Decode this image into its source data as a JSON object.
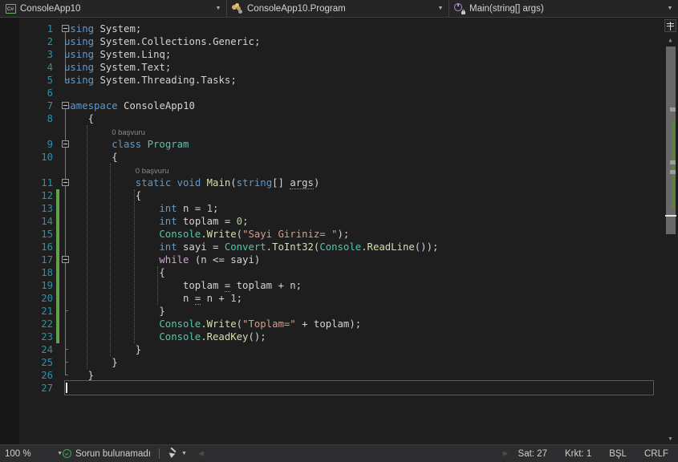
{
  "navbar": {
    "project": {
      "icon": "csharp-file-icon",
      "label": "ConsoleApp10"
    },
    "type": {
      "icon": "class-icon",
      "label": "ConsoleApp10.Program"
    },
    "member": {
      "icon": "method-private-icon",
      "label": "Main(string[] args)"
    }
  },
  "editor": {
    "first_line": 1,
    "codelens": [
      {
        "line": 9,
        "text": "0 başvuru"
      },
      {
        "line": 11,
        "text": "0 başvuru"
      }
    ],
    "lines": [
      {
        "n": 1,
        "tokens": [
          {
            "t": "using",
            "c": "k"
          },
          {
            "t": " ",
            "c": "pn"
          },
          {
            "t": "System",
            "c": "id"
          },
          {
            "t": ";",
            "c": "pn"
          }
        ],
        "indent": 0
      },
      {
        "n": 2,
        "tokens": [
          {
            "t": "using",
            "c": "k"
          },
          {
            "t": " ",
            "c": "pn"
          },
          {
            "t": "System.Collections.Generic",
            "c": "id"
          },
          {
            "t": ";",
            "c": "pn"
          }
        ],
        "indent": 0
      },
      {
        "n": 3,
        "tokens": [
          {
            "t": "using",
            "c": "k"
          },
          {
            "t": " ",
            "c": "pn"
          },
          {
            "t": "System.Linq",
            "c": "id"
          },
          {
            "t": ";",
            "c": "pn"
          }
        ],
        "indent": 0
      },
      {
        "n": 4,
        "tokens": [
          {
            "t": "using",
            "c": "k"
          },
          {
            "t": " ",
            "c": "pn"
          },
          {
            "t": "System.Text",
            "c": "id"
          },
          {
            "t": ";",
            "c": "pn"
          }
        ],
        "indent": 0
      },
      {
        "n": 5,
        "tokens": [
          {
            "t": "using",
            "c": "k"
          },
          {
            "t": " ",
            "c": "pn"
          },
          {
            "t": "System.Threading.Tasks",
            "c": "id"
          },
          {
            "t": ";",
            "c": "pn"
          }
        ],
        "indent": 0
      },
      {
        "n": 6,
        "tokens": [],
        "indent": 0
      },
      {
        "n": 7,
        "tokens": [
          {
            "t": "namespace",
            "c": "k"
          },
          {
            "t": " ",
            "c": "pn"
          },
          {
            "t": "ConsoleApp10",
            "c": "id"
          }
        ],
        "indent": 0
      },
      {
        "n": 8,
        "tokens": [
          {
            "t": "{",
            "c": "pn"
          }
        ],
        "indent": 1
      },
      {
        "n": 9,
        "tokens": [
          {
            "t": "class",
            "c": "k"
          },
          {
            "t": " ",
            "c": "pn"
          },
          {
            "t": "Program",
            "c": "ty"
          }
        ],
        "indent": 2
      },
      {
        "n": 10,
        "tokens": [
          {
            "t": "{",
            "c": "pn"
          }
        ],
        "indent": 2
      },
      {
        "n": 11,
        "tokens": [
          {
            "t": "static",
            "c": "k"
          },
          {
            "t": " ",
            "c": "pn"
          },
          {
            "t": "void",
            "c": "k"
          },
          {
            "t": " ",
            "c": "pn"
          },
          {
            "t": "Main",
            "c": "mth"
          },
          {
            "t": "(",
            "c": "pn"
          },
          {
            "t": "string",
            "c": "k"
          },
          {
            "t": "[] ",
            "c": "pn"
          },
          {
            "t": "args",
            "c": "id sq"
          },
          {
            "t": ")",
            "c": "pn"
          }
        ],
        "indent": 3
      },
      {
        "n": 12,
        "tokens": [
          {
            "t": "{",
            "c": "pn"
          }
        ],
        "indent": 3
      },
      {
        "n": 13,
        "tokens": [
          {
            "t": "int",
            "c": "k"
          },
          {
            "t": " n = ",
            "c": "pn"
          },
          {
            "t": "1",
            "c": "num"
          },
          {
            "t": ";",
            "c": "pn"
          }
        ],
        "indent": 4
      },
      {
        "n": 14,
        "tokens": [
          {
            "t": "int",
            "c": "k"
          },
          {
            "t": " toplam = ",
            "c": "pn"
          },
          {
            "t": "0",
            "c": "num"
          },
          {
            "t": ";",
            "c": "pn"
          }
        ],
        "indent": 4
      },
      {
        "n": 15,
        "tokens": [
          {
            "t": "Console",
            "c": "ty"
          },
          {
            "t": ".",
            "c": "pn"
          },
          {
            "t": "Write",
            "c": "mth"
          },
          {
            "t": "(",
            "c": "pn"
          },
          {
            "t": "\"Sayi Giriniz= \"",
            "c": "str"
          },
          {
            "t": ");",
            "c": "pn"
          }
        ],
        "indent": 4
      },
      {
        "n": 16,
        "tokens": [
          {
            "t": "int",
            "c": "k"
          },
          {
            "t": " sayi = ",
            "c": "pn"
          },
          {
            "t": "Convert",
            "c": "ty"
          },
          {
            "t": ".",
            "c": "pn"
          },
          {
            "t": "ToInt32",
            "c": "mth"
          },
          {
            "t": "(",
            "c": "pn"
          },
          {
            "t": "Console",
            "c": "ty"
          },
          {
            "t": ".",
            "c": "pn"
          },
          {
            "t": "ReadLine",
            "c": "mth"
          },
          {
            "t": "());",
            "c": "pn"
          }
        ],
        "indent": 4
      },
      {
        "n": 17,
        "tokens": [
          {
            "t": "while",
            "c": "kc"
          },
          {
            "t": " (n <= sayi)",
            "c": "pn"
          }
        ],
        "indent": 4
      },
      {
        "n": 18,
        "tokens": [
          {
            "t": "{",
            "c": "pn"
          }
        ],
        "indent": 4
      },
      {
        "n": 19,
        "tokens": [
          {
            "t": "toplam ",
            "c": "pn"
          },
          {
            "t": "=",
            "c": "pn sq"
          },
          {
            "t": " toplam + n;",
            "c": "pn"
          }
        ],
        "indent": 5
      },
      {
        "n": 20,
        "tokens": [
          {
            "t": "n ",
            "c": "pn"
          },
          {
            "t": "=",
            "c": "pn sq"
          },
          {
            "t": " n + ",
            "c": "pn"
          },
          {
            "t": "1",
            "c": "num"
          },
          {
            "t": ";",
            "c": "pn"
          }
        ],
        "indent": 5
      },
      {
        "n": 21,
        "tokens": [
          {
            "t": "}",
            "c": "pn"
          }
        ],
        "indent": 4
      },
      {
        "n": 22,
        "tokens": [
          {
            "t": "Console",
            "c": "ty"
          },
          {
            "t": ".",
            "c": "pn"
          },
          {
            "t": "Write",
            "c": "mth"
          },
          {
            "t": "(",
            "c": "pn"
          },
          {
            "t": "\"Toplam=\"",
            "c": "str"
          },
          {
            "t": " + toplam);",
            "c": "pn"
          }
        ],
        "indent": 4
      },
      {
        "n": 23,
        "tokens": [
          {
            "t": "Console",
            "c": "ty"
          },
          {
            "t": ".",
            "c": "pn"
          },
          {
            "t": "ReadKey",
            "c": "mth"
          },
          {
            "t": "();",
            "c": "pn"
          }
        ],
        "indent": 4
      },
      {
        "n": 24,
        "tokens": [
          {
            "t": "}",
            "c": "pn"
          }
        ],
        "indent": 3
      },
      {
        "n": 25,
        "tokens": [
          {
            "t": "}",
            "c": "pn"
          }
        ],
        "indent": 2
      },
      {
        "n": 26,
        "tokens": [
          {
            "t": "}",
            "c": "pn"
          }
        ],
        "indent": 1
      },
      {
        "n": 27,
        "tokens": [],
        "indent": 0
      }
    ],
    "fold_markers": [
      1,
      7,
      9,
      11,
      17
    ],
    "change_bar_lines": [
      12,
      23
    ],
    "current_line": 27,
    "colors": {
      "background": "#1e1e1e",
      "line_number": "#2b91af",
      "keyword": "#569cd6",
      "control_keyword": "#d8a0df",
      "type": "#4ec9b0",
      "method": "#dcdcaa",
      "string": "#d69d85",
      "number": "#b5cea8",
      "identifier": "#d4d4d4",
      "change_bar": "#63a14c"
    }
  },
  "statusbar": {
    "zoom": "100 %",
    "status_text": "Sorun bulunamadı",
    "status_icon": "check-circle-icon",
    "pen_icon": "highlighter-icon",
    "line_label": "Sat: 27",
    "col_label": "Krkt: 1",
    "insert_mode": "BŞL",
    "line_ending": "CRLF"
  }
}
